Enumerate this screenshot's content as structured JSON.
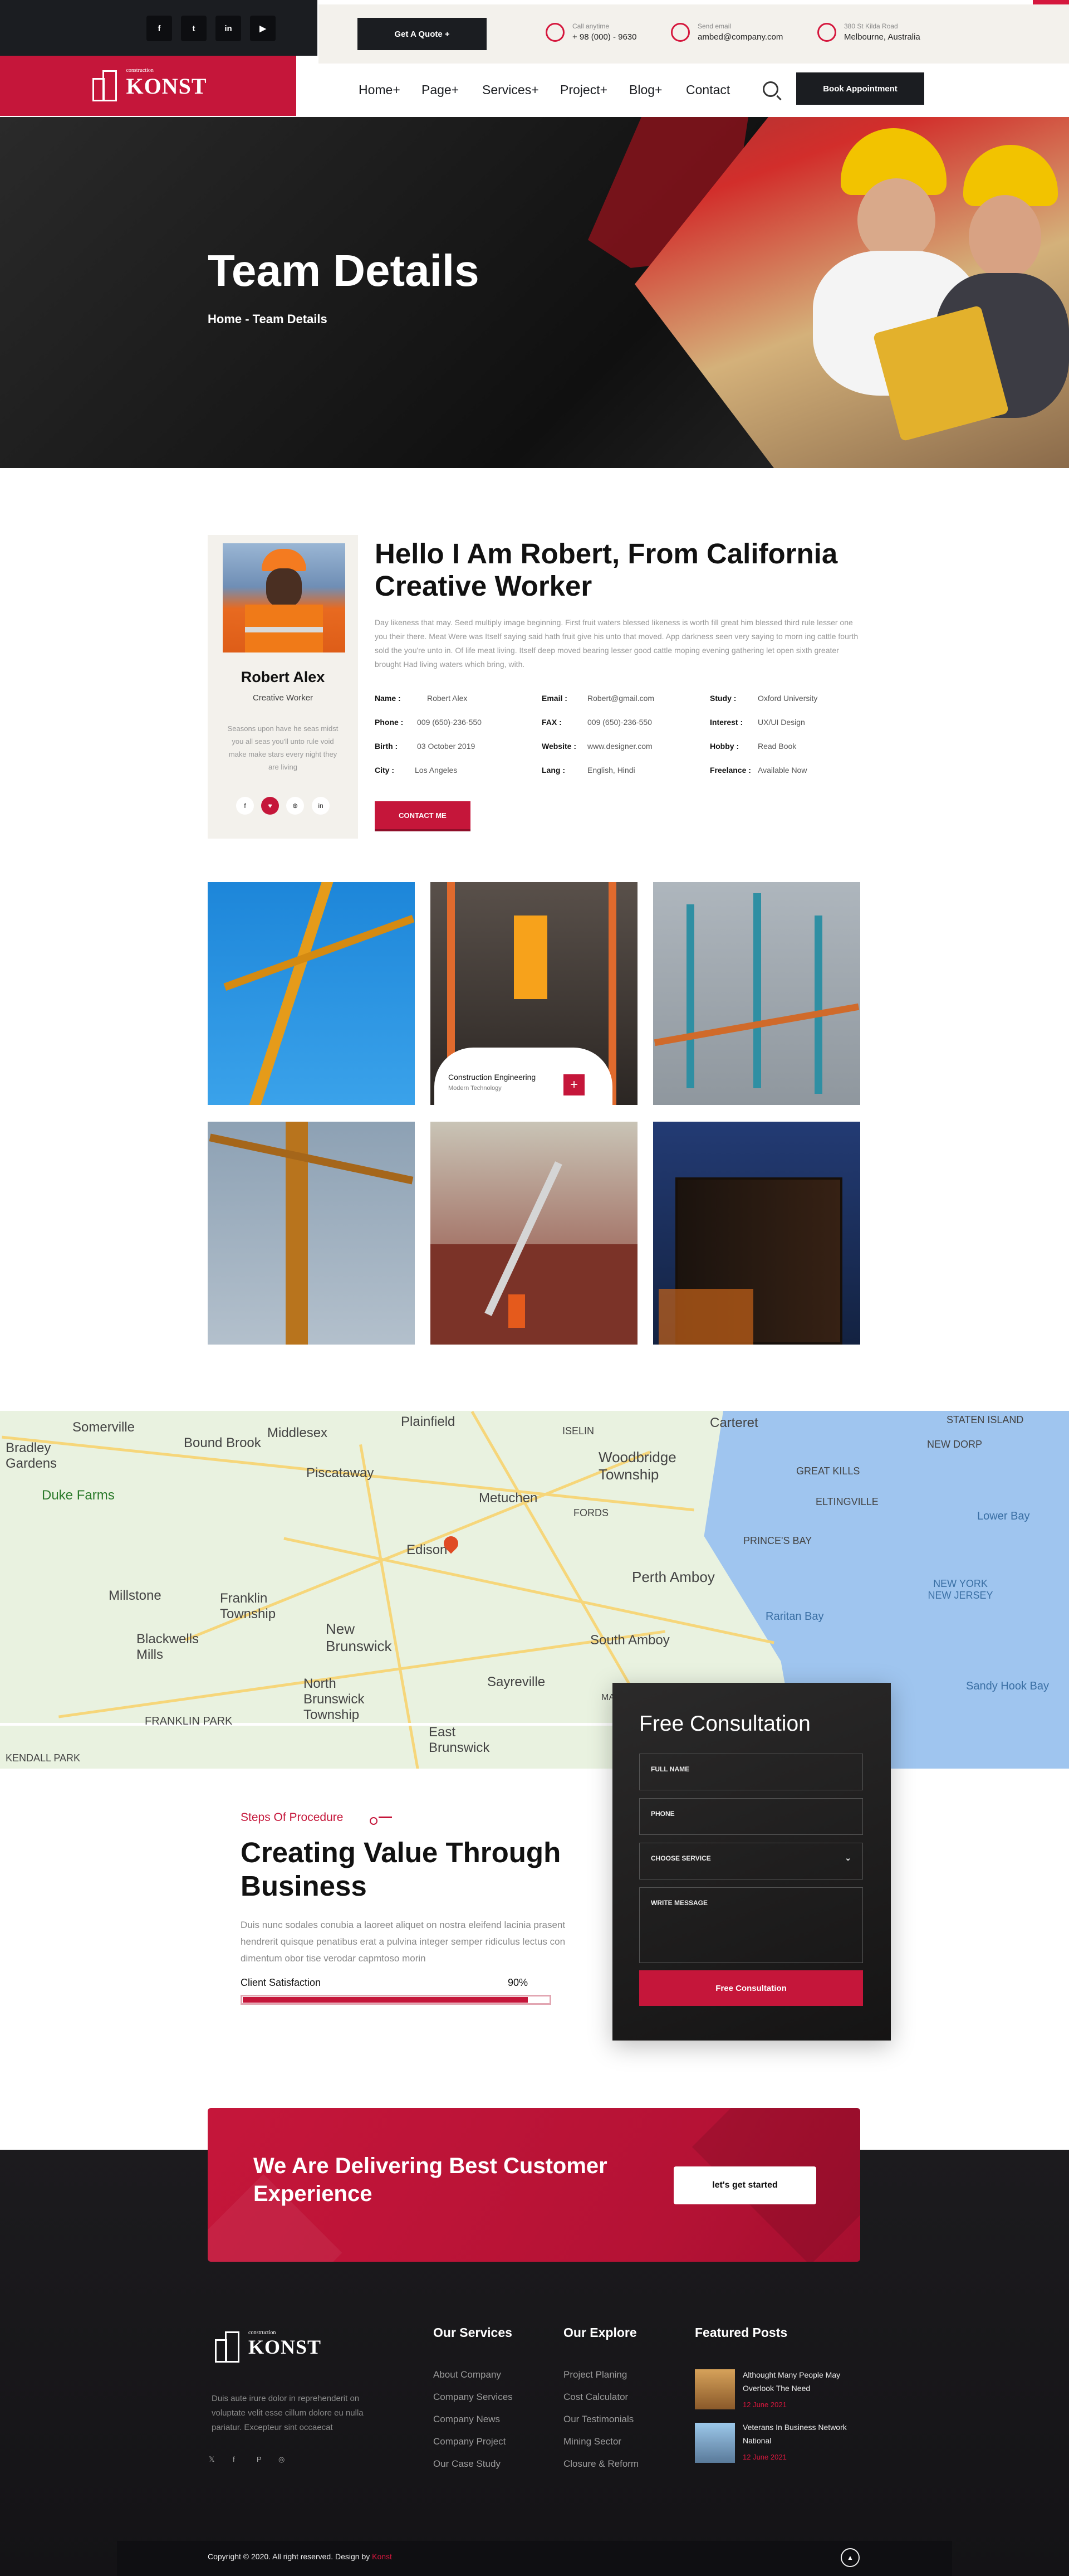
{
  "header": {
    "social": [
      "f",
      "t",
      "in",
      "▶"
    ],
    "logo_small": "construction",
    "logo": "KONST",
    "quote_label": "Get A Quote +",
    "call_label": "Call anytime",
    "call_value": "+ 98 (000) - 9630",
    "email_label": "Send email",
    "email_value": "ambed@company.com",
    "address_label": "380 St Kilda Road",
    "address_value": "Melbourne, Australia",
    "nav": [
      "Home+",
      "Page+",
      "Services+",
      "Project+",
      "Blog+",
      "Contact"
    ],
    "book_label": "Book Appointment"
  },
  "hero": {
    "title": "Team Details",
    "crumb": "Home - Team Details"
  },
  "profile": {
    "name": "Robert Alex",
    "role": "Creative Worker",
    "bio": "Seasons upon have he seas midst you all seas you'll unto rule void make make stars every night they are living",
    "heading": "Hello I Am Robert, From California Creative Worker",
    "description": "Day likeness that may. Seed multiply image beginning. First fruit waters blessed likeness is worth fill great him blessed third rule lesser one you their there. Meat Were was Itself saying said hath fruit give his unto that moved. App darkness seen very saying to morn ing cattle fourth sold the you're unto in. Of life meat living. Itself deep moved bearing lesser good cattle moping evening gathering let open sixth greater brought Had living waters which bring, with.",
    "fields": [
      {
        "k": "Name :",
        "v": "Robert Alex"
      },
      {
        "k": "Phone :",
        "v": "009 (650)-236-550"
      },
      {
        "k": "Birth :",
        "v": "03 October 2019"
      },
      {
        "k": "City :",
        "v": "Los Angeles"
      },
      {
        "k": "Email :",
        "v": "Robert@gmail.com"
      },
      {
        "k": "FAX :",
        "v": "009 (650)-236-550"
      },
      {
        "k": "Website :",
        "v": "www.designer.com"
      },
      {
        "k": "Lang :",
        "v": "English, Hindi"
      },
      {
        "k": "Study :",
        "v": "Oxford University"
      },
      {
        "k": "Interest :",
        "v": "UX/UI Design"
      },
      {
        "k": "Hobby :",
        "v": "Read Book"
      },
      {
        "k": "Freelance :",
        "v": "Available Now"
      }
    ],
    "contact_label": "CONTACT ME",
    "social": [
      "f",
      "♥",
      "⊕",
      "in"
    ]
  },
  "gallery": {
    "caption_title": "Construction Engineering",
    "caption_sub": "Modern Technology",
    "plus": "+"
  },
  "map": {
    "labels": [
      "Somerville",
      "Bound Brook",
      "Middlesex",
      "Piscataway",
      "Woodbridge Township",
      "Carteret",
      "Duke Farms",
      "Metuchen",
      "Edison",
      "Perth Amboy",
      "Franklin Township",
      "Millstone",
      "Blackwells Mills",
      "New Brunswick",
      "North Brunswick Township",
      "South Amboy",
      "Sayreville",
      "East Brunswick",
      "FRANKLIN PARK",
      "KENDALL PARK",
      "STATEN ISLAND",
      "NEW DORP",
      "GREAT KILLS",
      "ELTINGVILLE",
      "PRINCE'S BAY",
      "Raritan Bay",
      "NEW YORK NEW JERSEY",
      "Sandy Hook Bay",
      "Lower Bay",
      "Bradley Gardens",
      "Plainfield",
      "ISELIN",
      "FORDS",
      "MADISON PARK"
    ]
  },
  "consult": {
    "title": "Free Consultation",
    "fields": [
      "FULL NAME",
      "PHONE",
      "CHOOSE SERVICE",
      "WRITE MESSAGE"
    ],
    "button": "Free Consultation"
  },
  "procedure": {
    "tag": "Steps Of Procedure",
    "title": "Creating Value Through Business",
    "desc": "Duis nunc sodales conubia a laoreet aliquet on nostra eleifend lacinia prasent hendrerit quisque penatibus erat a pulvina integer semper ridiculus lectus con dimentum obor tise verodar capmtoso morin",
    "skill_label": "Client Satisfaction",
    "skill_value": "90%",
    "skill_fraction": 0.93
  },
  "cta": {
    "title": "We Are Delivering Best Customer Experience",
    "button": "let's get started"
  },
  "footer": {
    "about": "Duis aute irure dolor in reprehenderit on voluptate velit esse cillum dolore eu nulla pariatur. Excepteur sint occaecat",
    "social": [
      "𝕏",
      "f",
      "P",
      "◎"
    ],
    "services_title": "Our Services",
    "services": [
      "About Company",
      "Company Services",
      "Company News",
      "Company Project",
      "Our Case Study"
    ],
    "explore_title": "Our Explore",
    "explore": [
      "Project Planing",
      "Cost Calculator",
      "Our Testimonials",
      "Mining Sector",
      "Closure & Reform"
    ],
    "posts_title": "Featured Posts",
    "posts": [
      {
        "title": "Althought Many People May Overlook The Need",
        "date": "12 June 2021"
      },
      {
        "title": "Veterans In Business Network National",
        "date": "12 June 2021"
      }
    ],
    "copyright": "Copyright © 2020. All right reserved. Design by",
    "copyright_brand": "Konst",
    "up": "▲"
  },
  "colors": {
    "accent": "#c5163a",
    "dark": "#1b1d21",
    "cream": "#f3f1ec"
  }
}
